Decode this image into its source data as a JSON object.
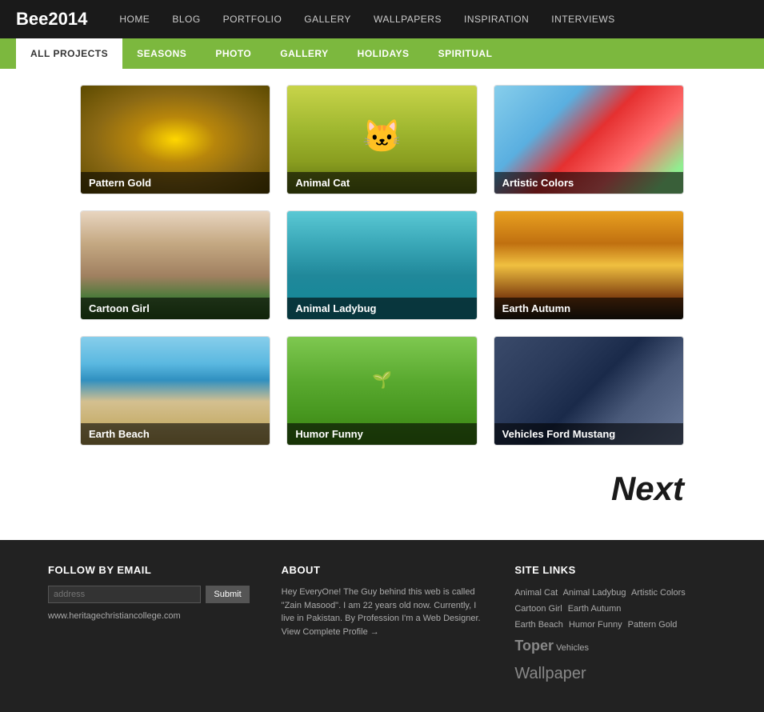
{
  "site": {
    "logo": "Bee2014",
    "top_nav": [
      {
        "label": "HOME",
        "url": "#"
      },
      {
        "label": "BLOG",
        "url": "#"
      },
      {
        "label": "PORTFOLIO",
        "url": "#"
      },
      {
        "label": "GALLERY",
        "url": "#"
      },
      {
        "label": "WALLPAPERS",
        "url": "#"
      },
      {
        "label": "INSPIRATION",
        "url": "#"
      },
      {
        "label": "INTERVIEWS",
        "url": "#"
      }
    ],
    "sub_nav": [
      {
        "label": "ALL PROJECTS",
        "active": true
      },
      {
        "label": "SEASONS",
        "active": false
      },
      {
        "label": "PHOTO",
        "active": false
      },
      {
        "label": "GALLERY",
        "active": false
      },
      {
        "label": "HOLIDAYS",
        "active": false
      },
      {
        "label": "SPIRITUAL",
        "active": false
      }
    ]
  },
  "gallery": {
    "items": [
      {
        "label": "Pattern Gold",
        "img_class": "img-pattern-gold"
      },
      {
        "label": "Animal Cat",
        "img_class": "img-animal-cat"
      },
      {
        "label": "Artistic Colors",
        "img_class": "img-artistic-colors"
      },
      {
        "label": "Cartoon Girl",
        "img_class": "img-cartoon-girl"
      },
      {
        "label": "Animal Ladybug",
        "img_class": "img-animal-ladybug"
      },
      {
        "label": "Earth Autumn",
        "img_class": "img-earth-autumn"
      },
      {
        "label": "Earth Beach",
        "img_class": "img-earth-beach"
      },
      {
        "label": "Humor Funny",
        "img_class": "img-humor-funny"
      },
      {
        "label": "Vehicles Ford Mustang",
        "img_class": "img-vehicles-ford"
      }
    ]
  },
  "pagination": {
    "next_label": "Next"
  },
  "footer": {
    "follow_title": "FOLLOW BY EMAIL",
    "email_placeholder": "address",
    "submit_label": "Submit",
    "footer_url": "www.heritagechristiancollege.com",
    "about_title": "ABOUT",
    "about_text": "Hey EveryOne! The Guy behind this web is called \"Zain Masood\". I am 22 years old now. Currently, I live in Pakistan. By Profession I'm a Web Designer.",
    "view_profile": "View Complete Profile →",
    "site_links_title": "SITE LINKS",
    "site_links": [
      "Animal Cat",
      "Animal Ladybug",
      "Artistic Colors",
      "Cartoon Girl",
      "Earth Autumn",
      "Earth Beach",
      "Humor Funny",
      "Pattern Gold",
      "Toper",
      "Vehicles",
      "Wallpaper"
    ]
  }
}
